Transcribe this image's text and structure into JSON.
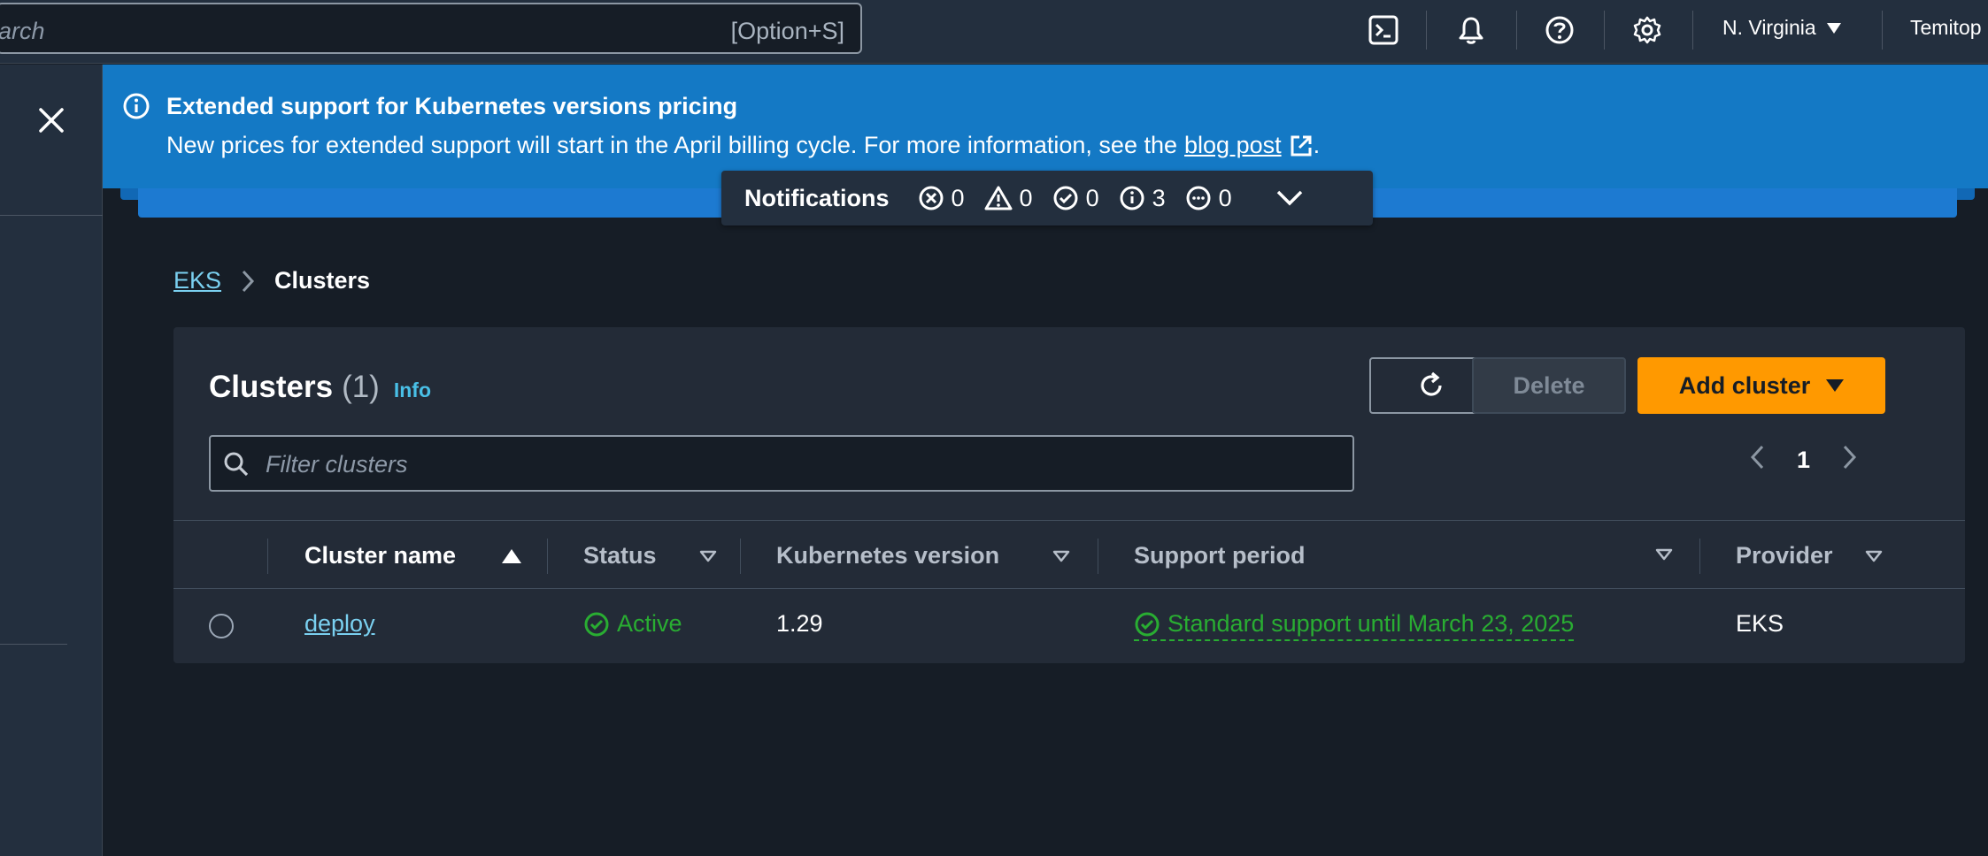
{
  "topbar": {
    "search_text": "arch",
    "search_shortcut": "[Option+S]",
    "region": "N. Virginia",
    "user": "Temitop"
  },
  "banner": {
    "title": "Extended support for Kubernetes versions pricing",
    "body": "New prices for extended support will start in the April billing cycle. For more information, see the",
    "link": "blog post",
    "trailing": "."
  },
  "notifications": {
    "title": "Notifications",
    "error_count": "0",
    "warning_count": "0",
    "success_count": "0",
    "info_count": "3",
    "in_progress_count": "0"
  },
  "breadcrumb": {
    "root": "EKS",
    "current": "Clusters"
  },
  "clusters": {
    "title": "Clusters",
    "count": "(1)",
    "info": "Info",
    "delete_label": "Delete",
    "add_label": "Add cluster",
    "filter_placeholder": "Filter clusters",
    "page": "1",
    "columns": {
      "name": "Cluster name",
      "status": "Status",
      "version": "Kubernetes version",
      "support": "Support period",
      "provider": "Provider"
    },
    "rows": [
      {
        "name": "deploy",
        "status": "Active",
        "version": "1.29",
        "support": "Standard support until March 23, 2025",
        "provider": "EKS"
      }
    ]
  },
  "colors": {
    "accent_orange": "#ff9900",
    "banner_blue": "#1479c5",
    "link_blue": "#7ad0f0",
    "success_green": "#29ad32"
  }
}
